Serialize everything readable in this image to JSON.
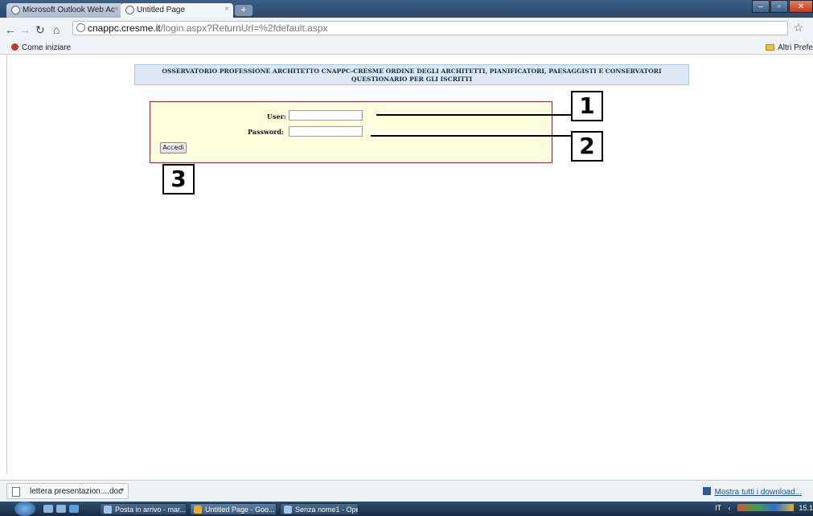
{
  "browser": {
    "tabs": [
      {
        "label": "Microsoft Outlook Web Ac",
        "active": false
      },
      {
        "label": "Untitled Page",
        "active": true
      }
    ],
    "new_tab_label": "+",
    "address": {
      "host": "cnappc.cresme.it",
      "path": "/login.aspx?ReturnUrl=%2fdefault.aspx"
    },
    "bookmarks": {
      "left": "Come iniziare",
      "right": "Altri Prefe"
    }
  },
  "page": {
    "banner_line1": "OSSERVATORIO PROFESSIONE ARCHITETTO CNAPPC-CRESME ORDINE DEGLI ARCHITETTI, PIANIFICATORI, PAESAGGISTI E CONSERVATORI",
    "banner_line2": "QUESTIONARIO PER GLI ISCRITTI",
    "login": {
      "user_label": "User:",
      "password_label": "Password:",
      "user_value": "",
      "password_value": "",
      "submit_label": "Accedi"
    },
    "callouts": [
      "1",
      "2",
      "3"
    ]
  },
  "downloads": {
    "item": "lettera presentazion....doc",
    "show_all": "Mostra tutti i download..."
  },
  "taskbar": {
    "buttons": [
      "Posta in arrivo - mar...",
      "Untitled Page - Goo...",
      "Senza nome1 - Ope..."
    ],
    "tray_lang": "IT",
    "clock": "15.1"
  }
}
